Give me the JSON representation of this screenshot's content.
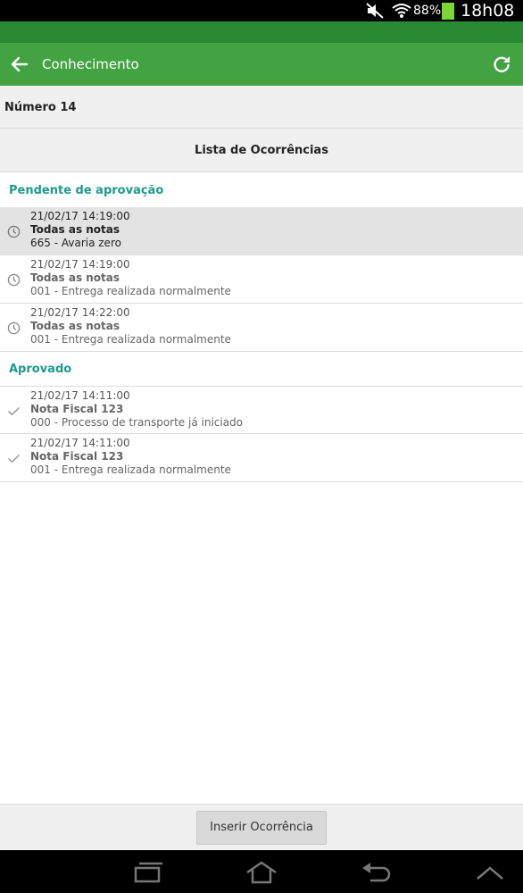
{
  "status_bar": {
    "battery_text": "88%",
    "time": "18h08",
    "icons": [
      "mute-icon",
      "wifi-icon",
      "battery-icon"
    ],
    "battery_color": "#7cd636"
  },
  "toolbar": {
    "title": "Conhecimento",
    "back_icon": "arrow-left-icon",
    "refresh_icon": "refresh-icon",
    "color": "#43a343"
  },
  "header": {
    "numero_label": "Número 14",
    "list_title": "Lista de Ocorrências"
  },
  "sections": [
    {
      "title": "Pendente de aprovação",
      "icon": "clock-icon",
      "items": [
        {
          "date": "21/02/17 14:19:00",
          "title": "Todas as notas",
          "desc": "665 - Avaria zero",
          "selected": true
        },
        {
          "date": "21/02/17 14:19:00",
          "title": "Todas as notas",
          "desc": "001 - Entrega realizada normalmente",
          "selected": false
        },
        {
          "date": "21/02/17 14:22:00",
          "title": "Todas as notas",
          "desc": "001 - Entrega realizada normalmente",
          "selected": false
        }
      ]
    },
    {
      "title": "Aprovado",
      "icon": "check-icon",
      "items": [
        {
          "date": "21/02/17 14:11:00",
          "title": "Nota Fiscal 123",
          "desc": "000 - Processo de transporte já iniciado",
          "selected": false
        },
        {
          "date": "21/02/17 14:11:00",
          "title": "Nota Fiscal 123",
          "desc": "001 - Entrega realizada normalmente",
          "selected": false
        }
      ]
    }
  ],
  "bottom": {
    "insert_button_label": "Inserir Ocorrência"
  },
  "nav_bar": {
    "icons": [
      "recent-apps-icon",
      "home-icon",
      "back-icon",
      "chevron-up-icon"
    ]
  },
  "accent_color": "#1a9c8c"
}
